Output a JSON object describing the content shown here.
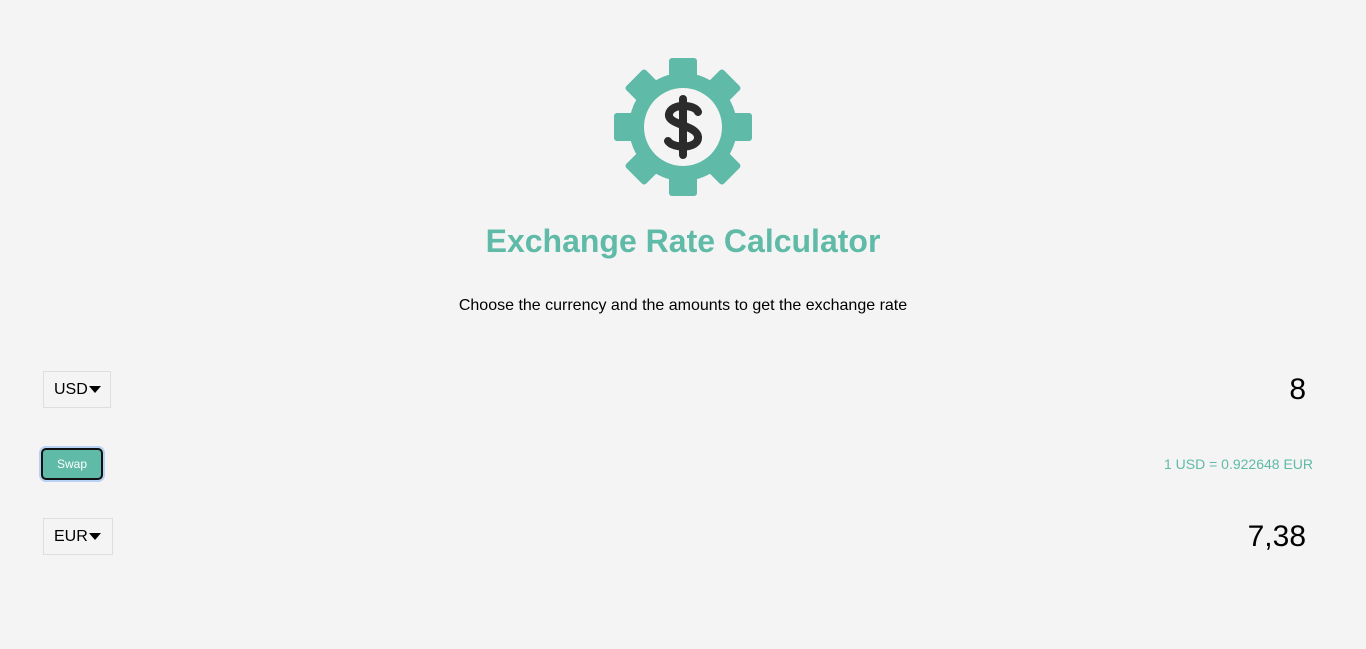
{
  "header": {
    "logo_icon": "gear-dollar-icon",
    "title": "Exchange Rate Calculator",
    "subtitle": "Choose the currency and the amounts to get the exchange rate"
  },
  "converter": {
    "currency_one": "USD",
    "amount_one": "8",
    "swap_label": "Swap",
    "rate_text": "1 USD = 0.922648 EUR",
    "currency_two": "EUR",
    "amount_two": "7,38"
  },
  "colors": {
    "accent": "#5fbaa7",
    "background": "#f4f4f4",
    "icon_dark": "#2b2b2b"
  }
}
